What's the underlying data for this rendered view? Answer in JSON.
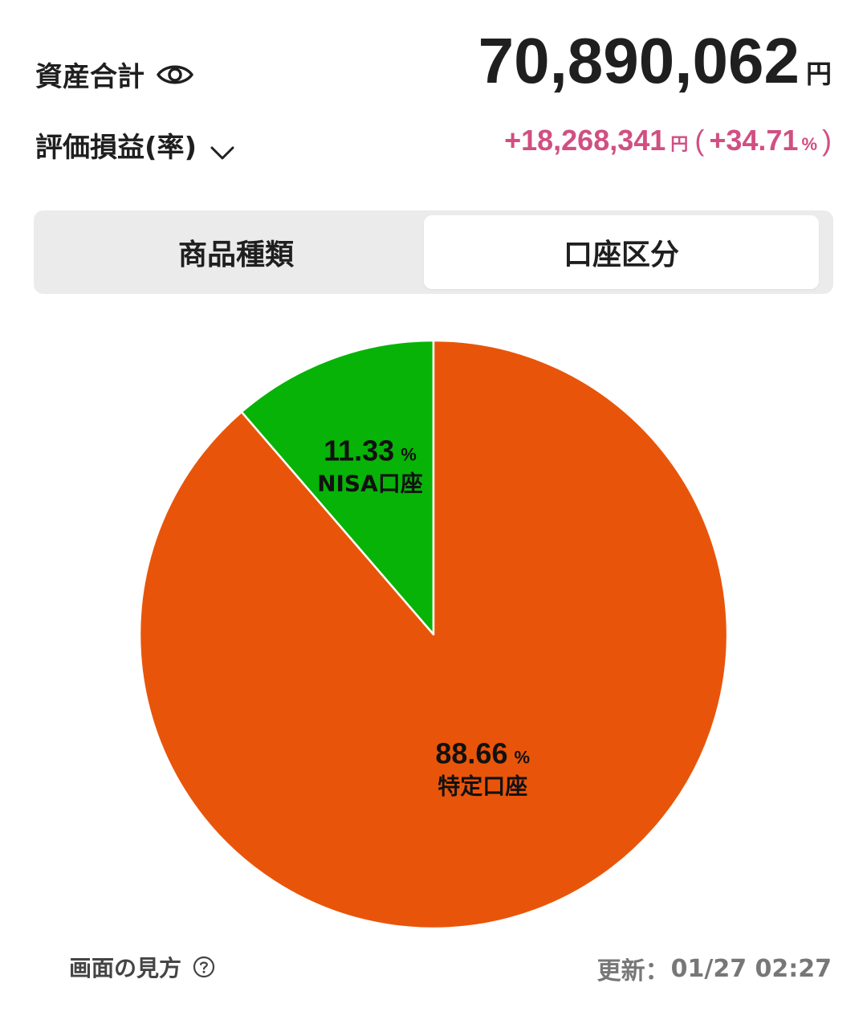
{
  "summary": {
    "total_label": "資産合計",
    "total_amount": "70,890,062",
    "total_unit": "円",
    "pl_label": "評価損益(率)",
    "pl_amount": "+18,268,341",
    "pl_unit": "円",
    "pl_paren_open": "(",
    "pl_rate": "+34.71",
    "pl_rate_unit": "%",
    "pl_paren_close": ")",
    "pl_color": "#d14f82"
  },
  "tabs": [
    {
      "label": "商品種類",
      "selected": false
    },
    {
      "label": "口座区分",
      "selected": true
    }
  ],
  "icons": {
    "eye": "eye-icon",
    "chevron": "chevron-down-icon",
    "help": "question-circle-icon"
  },
  "chart_data": {
    "type": "pie",
    "start_angle_deg": -90,
    "direction": "counterclockwise",
    "slices": [
      {
        "label": "NISA口座",
        "value": 11.33,
        "value_text": "11.33",
        "unit": "%",
        "color": "#07b307"
      },
      {
        "label": "特定口座",
        "value": 88.66,
        "value_text": "88.66",
        "unit": "%",
        "color": "#e8550a"
      }
    ]
  },
  "footer": {
    "help_label": "画面の見方",
    "updated_label": "更新：",
    "updated_time": "01/27 02:27"
  }
}
